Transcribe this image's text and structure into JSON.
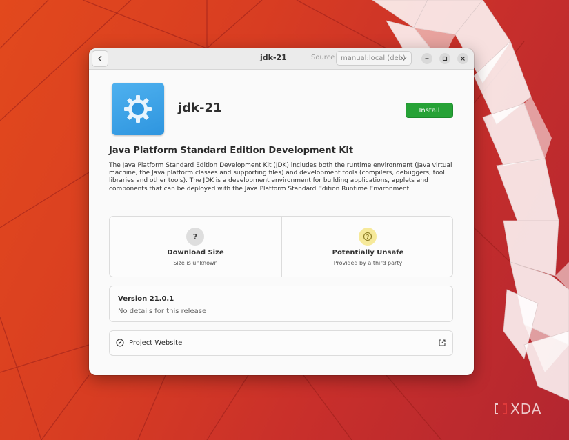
{
  "window": {
    "title": "jdk-21",
    "source_label": "Source",
    "source_value": "manual:local (deb)"
  },
  "app": {
    "name": "jdk-21",
    "install_label": "Install",
    "summary": "Java Platform Standard Edition Development Kit",
    "description": "The Java Platform Standard Edition Development Kit (JDK) includes both the runtime environment (Java virtual machine, the Java platform classes and supporting files) and development tools (compilers, debuggers, tool libraries and other tools). The JDK is a development environment for building applications, applets and components that can be deployed with the Java Platform Standard Edition Runtime Environment."
  },
  "context": {
    "download": {
      "icon_text": "?",
      "title": "Download Size",
      "subtitle": "Size is unknown"
    },
    "safety": {
      "icon_text": "?",
      "title": "Potentially Unsafe",
      "subtitle": "Provided by a third party"
    }
  },
  "version": {
    "title": "Version 21.0.1",
    "details": "No details for this release"
  },
  "links": {
    "project_website": "Project Website"
  },
  "watermark": {
    "text": "XDA"
  },
  "colors": {
    "accent_install": "#26a236",
    "app_icon_blue": "#3aa3e8",
    "unsafe_badge": "#f6e99a"
  }
}
